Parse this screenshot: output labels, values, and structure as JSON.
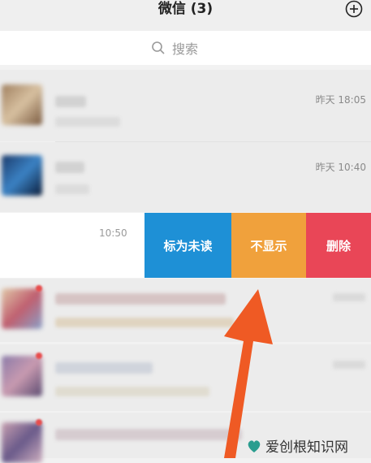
{
  "header": {
    "title": "微信 (3)",
    "add_icon": "plus-circle-icon"
  },
  "search": {
    "placeholder": "搜索",
    "icon": "search-icon"
  },
  "chats": [
    {
      "time": "昨天 18:05"
    },
    {
      "time": "昨天 10:40"
    }
  ],
  "swipe_row": {
    "time": "10:50",
    "actions": {
      "mark_unread": "标为未读",
      "hide": "不显示",
      "delete": "删除"
    }
  },
  "colors": {
    "mark_unread": "#1e90d6",
    "hide": "#f0a13c",
    "delete": "#e94657",
    "arrow": "#ef5a24"
  },
  "watermark": {
    "text": "爱创根知识网"
  }
}
